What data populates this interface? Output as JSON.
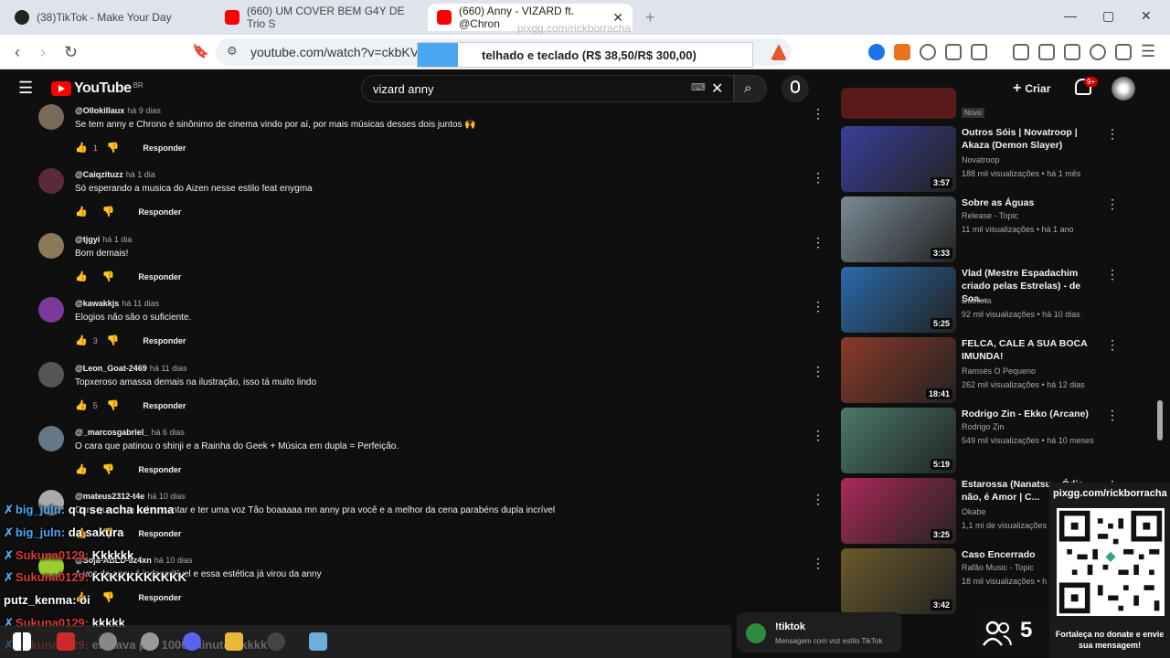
{
  "browser": {
    "tabs": [
      {
        "label": "(38)TikTok - Make Your Day",
        "color": "#222222"
      },
      {
        "label": "(660) UM COVER BEM G4Y DE Trio S",
        "color": "#ff0000"
      },
      {
        "label": "(660) Anny - VIZARD ft. @Chron",
        "color": "#ff0000"
      }
    ],
    "new_tab": "+",
    "url": "youtube.com/watch?v=ckbKV9j",
    "minimize": "—",
    "maximize": "▢",
    "close": "✕"
  },
  "donation_bar": {
    "text": "telhado e teclado (R$ 38,50/R$ 300,00)"
  },
  "overlay_url": "pixgg.com/rickborracha",
  "youtube": {
    "logo": "YouTube",
    "country": "BR",
    "search_query": "vizard anny",
    "create_label": "Criar",
    "notifications": "9+"
  },
  "comments": [
    {
      "user": "@Ollokillaux",
      "time": "há 9 dias",
      "text": "Se tem anny e Chrono é sinônimo de cinema vindo por aí, por mais músicas desses dois juntos 🙌",
      "likes": "1",
      "reply": "Responder",
      "avatar": "#7a6a5a"
    },
    {
      "user": "@Caiqzituzz",
      "time": "há 1 dia",
      "text": "Só esperando a musica do Aizen nesse estilo feat enygma",
      "likes": "",
      "reply": "Responder",
      "avatar": "#5a2a3a"
    },
    {
      "user": "@tjgyi",
      "time": "há 1 dia",
      "text": "Bom demais!",
      "likes": "",
      "reply": "Responder",
      "avatar": "#8a7a5a"
    },
    {
      "user": "@kawakkjs",
      "time": "há 11 dias",
      "text": "Elogios não são o suficiente.",
      "likes": "3",
      "reply": "Responder",
      "avatar": "#7a3a9a"
    },
    {
      "user": "@Leon_Goat-2469",
      "time": "há 11 dias",
      "text": "Topxeroso amassa demais na ilustração, isso tá muito lindo",
      "likes": "5",
      "reply": "Responder",
      "avatar": "#555555"
    },
    {
      "user": "@_marcosgabriel_",
      "time": "há 6 dias",
      "text": "O cara que patinou o shinji e a Rainha do Geek + Música em dupla = Perfeição.",
      "likes": "",
      "reply": "Responder",
      "avatar": "#667788"
    },
    {
      "user": "@mateus2312-t4e",
      "time": "há 10 dias",
      "text": "Cara que sinta saber cantar e ter uma voz Tão boaaaaa mn anny pra você e a melhor da cena parabéns dupla incrível",
      "likes": "",
      "reply": "Responder",
      "avatar": "#aaaaaa"
    },
    {
      "user": "@Soja-ABLD-8z4xn",
      "time": "há 10 dias",
      "text": "A voz da anny é indescritível e essa estética já virou da anny",
      "likes": "",
      "reply": "Responder",
      "avatar": "#9acd32"
    }
  ],
  "sidebar_videos": [
    {
      "title": "Outros Sóis | Novatroop | Akaza (Demon Slayer)",
      "channel": "Novatroop",
      "meta": "188 mil visualizações • há 1 mês",
      "duration": "3:57",
      "color": "#3a3f9a"
    },
    {
      "title": "Sobre as Águas",
      "channel": "Release - Topic",
      "meta": "11 mil visualizações • há 1 ano",
      "duration": "3:33",
      "color": "#7a8a95"
    },
    {
      "title": "Vlad (Mestre Espadachim criado pelas Estrelas) - de Soa...",
      "channel": "Duelista",
      "meta": "92 mil visualizações • há 10 dias",
      "duration": "5:25",
      "color": "#2a6aaa"
    },
    {
      "title": "FELCA, CALE A SUA BOCA IMUNDA!",
      "channel": "Ramsés O Pequeno",
      "meta": "262 mil visualizações • há 12 dias",
      "duration": "18:41",
      "color": "#8a3a2a"
    },
    {
      "title": "Rodrigo Zin - Ekko (Arcane)",
      "channel": "Rodrigo Zin",
      "meta": "549 mil visualizações • há 10 meses",
      "duration": "5:19",
      "color": "#4a7a6a"
    },
    {
      "title": "Estarossa (Nanatsu... Ódio não, é Amor | C...",
      "channel": "Okabe",
      "meta": "1,1 mi de visualizações",
      "duration": "3:25",
      "color": "#aa2a5a"
    },
    {
      "title": "Caso Encerrado",
      "channel": "Rafão Music - Topic",
      "meta": "18 mil visualizações • h",
      "duration": "3:42",
      "color": "#6a5a2a"
    }
  ],
  "sidebar_top_label": "Novo",
  "chat": [
    {
      "user": "big_juln:",
      "msg": "q q se acha kenma",
      "color": "blue"
    },
    {
      "user": "big_juln:",
      "msg": "da sakura",
      "color": "blue"
    },
    {
      "user": "Sukuna0129:",
      "msg": "Kkkkkk",
      "color": "red"
    },
    {
      "user": "Sukuna0129:",
      "msg": "KKKKKKKKKKK",
      "color": "red"
    },
    {
      "user": "putz_kenma:",
      "msg": "oi",
      "color": "white"
    },
    {
      "user": "Sukuna0129:",
      "msg": "kkkkk",
      "color": "red"
    },
    {
      "user": "Sukuna0129:",
      "msg": "ele tava por 1000 minutos kkkk",
      "color": "red"
    }
  ],
  "qr": {
    "label": "pixgg.com/rickborracha",
    "caption": "Fortaleça no donate e envie sua mensagem!"
  },
  "viewers": "5",
  "tiktok_notice": {
    "title": "!tiktok",
    "subtitle": "Mensagem com voz estilo TikTok"
  }
}
